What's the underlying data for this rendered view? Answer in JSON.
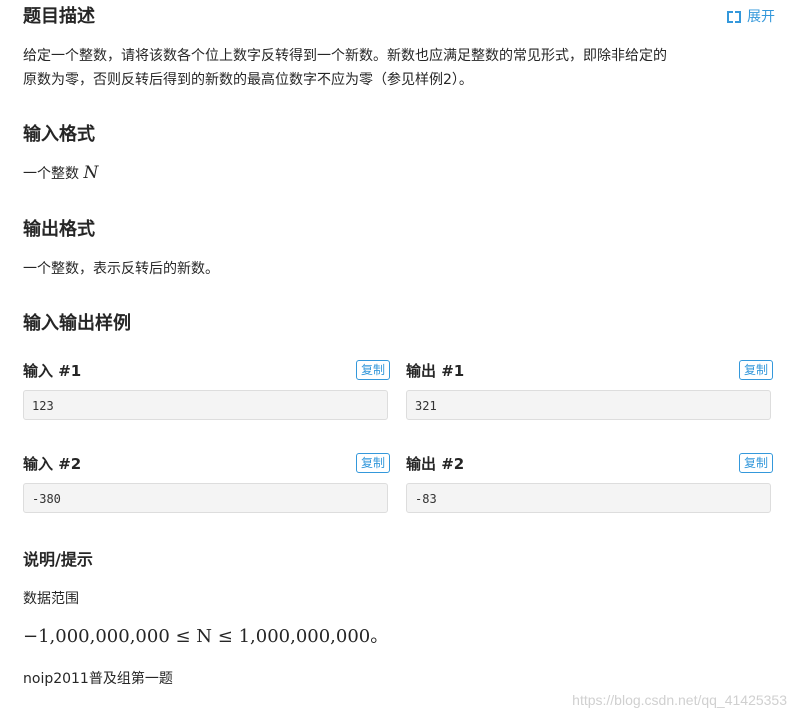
{
  "problem": {
    "title": "题目描述",
    "expand_label": "展开",
    "expand_icon": "expand-icon",
    "description_line1": "给定一个整数，请将该数各个位上数字反转得到一个新数。新数也应满足整数的常见形式，即除非给定的",
    "description_line2": "原数为零，否则反转后得到的新数的最高位数字不应为零（参见样例2）。"
  },
  "input_format": {
    "title": "输入格式",
    "text": "一个整数 ",
    "var": "N"
  },
  "output_format": {
    "title": "输出格式",
    "text": "一个整数，表示反转后的新数。"
  },
  "samples": {
    "title": "输入输出样例",
    "copy_label": "复制",
    "items": [
      {
        "input_label": "输入 #1",
        "input": "123",
        "output_label": "输出 #1",
        "output": "321"
      },
      {
        "input_label": "输入 #2",
        "input": "-380",
        "output_label": "输出 #2",
        "output": "-83"
      }
    ]
  },
  "hint": {
    "title": "说明/提示",
    "range_label": "数据范围",
    "range_math": "−1,000,000,000 ≤ N ≤ 1,000,000,000。",
    "source": "noip2011普及组第一题"
  },
  "watermark": "https://blog.csdn.net/qq_41425353",
  "colors": {
    "accent": "#3498db",
    "text": "#262626",
    "code_bg": "#f4f4f4"
  }
}
